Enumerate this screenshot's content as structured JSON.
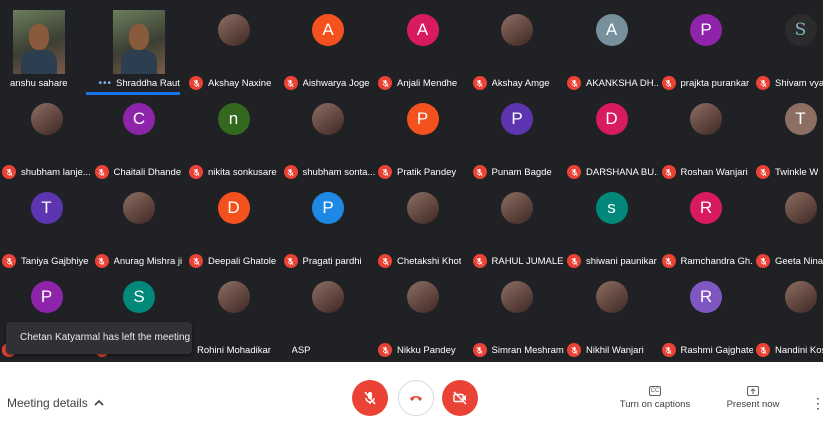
{
  "participants": [
    {
      "name": "anshu sahare",
      "kind": "video",
      "muted": false
    },
    {
      "name": "Shraddha Raut",
      "kind": "video",
      "muted": false,
      "speaking": true
    },
    {
      "name": "Akshay Naxine",
      "kind": "photo",
      "muted": true
    },
    {
      "name": "Aishwarya Joge",
      "kind": "letter",
      "letter": "A",
      "color": "#f4511e",
      "muted": true
    },
    {
      "name": "Anjali Mendhe",
      "kind": "letter",
      "letter": "A",
      "color": "#d81b60",
      "muted": true
    },
    {
      "name": "Akshay Amge",
      "kind": "photo",
      "muted": true
    },
    {
      "name": "AKANKSHA DH...",
      "kind": "letter",
      "letter": "A",
      "color": "#78909c",
      "muted": true
    },
    {
      "name": "prajkta purankar",
      "kind": "letter",
      "letter": "P",
      "color": "#8e24aa",
      "muted": true
    },
    {
      "name": "Shivam vyas",
      "kind": "glyph",
      "letter": "S",
      "muted": true
    },
    {
      "name": "shubham lanje...",
      "kind": "photo",
      "muted": true
    },
    {
      "name": "Chaitali Dhande",
      "kind": "letter",
      "letter": "C",
      "color": "#8e24aa",
      "muted": true
    },
    {
      "name": "nikita sonkusare",
      "kind": "letter",
      "letter": "n",
      "color": "#33691e",
      "muted": true
    },
    {
      "name": "shubham sonta...",
      "kind": "photo",
      "muted": true
    },
    {
      "name": "Pratik Pandey",
      "kind": "letter",
      "letter": "P",
      "color": "#f4511e",
      "muted": true
    },
    {
      "name": "Punam Bagde",
      "kind": "letter",
      "letter": "P",
      "color": "#5e35b1",
      "muted": true
    },
    {
      "name": "DARSHANA BU...",
      "kind": "letter",
      "letter": "D",
      "color": "#d81b60",
      "muted": true
    },
    {
      "name": "Roshan Wanjari",
      "kind": "photo",
      "muted": true
    },
    {
      "name": "Twinkle W",
      "kind": "letter",
      "letter": "T",
      "color": "#8d6e63",
      "muted": true
    },
    {
      "name": "Taniya Gajbhiye",
      "kind": "letter",
      "letter": "T",
      "color": "#5e35b1",
      "muted": true
    },
    {
      "name": "Anurag Mishra ji",
      "kind": "photo",
      "muted": true
    },
    {
      "name": "Deepali Ghatole",
      "kind": "letter",
      "letter": "D",
      "color": "#f4511e",
      "muted": true
    },
    {
      "name": "Pragati pardhi",
      "kind": "letter",
      "letter": "P",
      "color": "#1e88e5",
      "muted": true
    },
    {
      "name": "Chetakshi Khot",
      "kind": "photo",
      "muted": true
    },
    {
      "name": "RAHUL JUMALE",
      "kind": "photo",
      "muted": true
    },
    {
      "name": "shiwani paunikar",
      "kind": "letter",
      "letter": "s",
      "color": "#00897b",
      "muted": true
    },
    {
      "name": "Ramchandra Gh...",
      "kind": "letter",
      "letter": "R",
      "color": "#d81b60",
      "muted": true
    },
    {
      "name": "Geeta Ninawe",
      "kind": "photo",
      "muted": true
    },
    {
      "name": "",
      "kind": "letter",
      "letter": "P",
      "color": "#8e24aa",
      "muted": true
    },
    {
      "name": "",
      "kind": "letter",
      "letter": "S",
      "color": "#00897b",
      "muted": true
    },
    {
      "name": "Rohini Mohadikar",
      "kind": "photo",
      "muted": false
    },
    {
      "name": "ASP",
      "kind": "photo",
      "muted": false
    },
    {
      "name": "Nikku Pandey",
      "kind": "photo",
      "muted": true
    },
    {
      "name": "Simran Meshram",
      "kind": "photo",
      "muted": true
    },
    {
      "name": "Nikhil Wanjari",
      "kind": "photo",
      "muted": true
    },
    {
      "name": "Rashmi Gajghate",
      "kind": "letter",
      "letter": "R",
      "color": "#7e57c2",
      "muted": true
    },
    {
      "name": "Nandini Kose",
      "kind": "photo",
      "muted": true
    }
  ],
  "toast": {
    "text": "Chetan Katyarmal has left the meeting"
  },
  "controls": {
    "meeting_details_label": "Meeting details",
    "captions_label": "Turn on captions",
    "present_label": "Present now",
    "captions_icon": "CC",
    "more_icon": "⋮",
    "details_chevron": "^",
    "dots": "•••"
  },
  "colors": {
    "stage_bg": "#202124",
    "mic_red": "#ea4335",
    "speaking_blue": "#1a73e8"
  }
}
